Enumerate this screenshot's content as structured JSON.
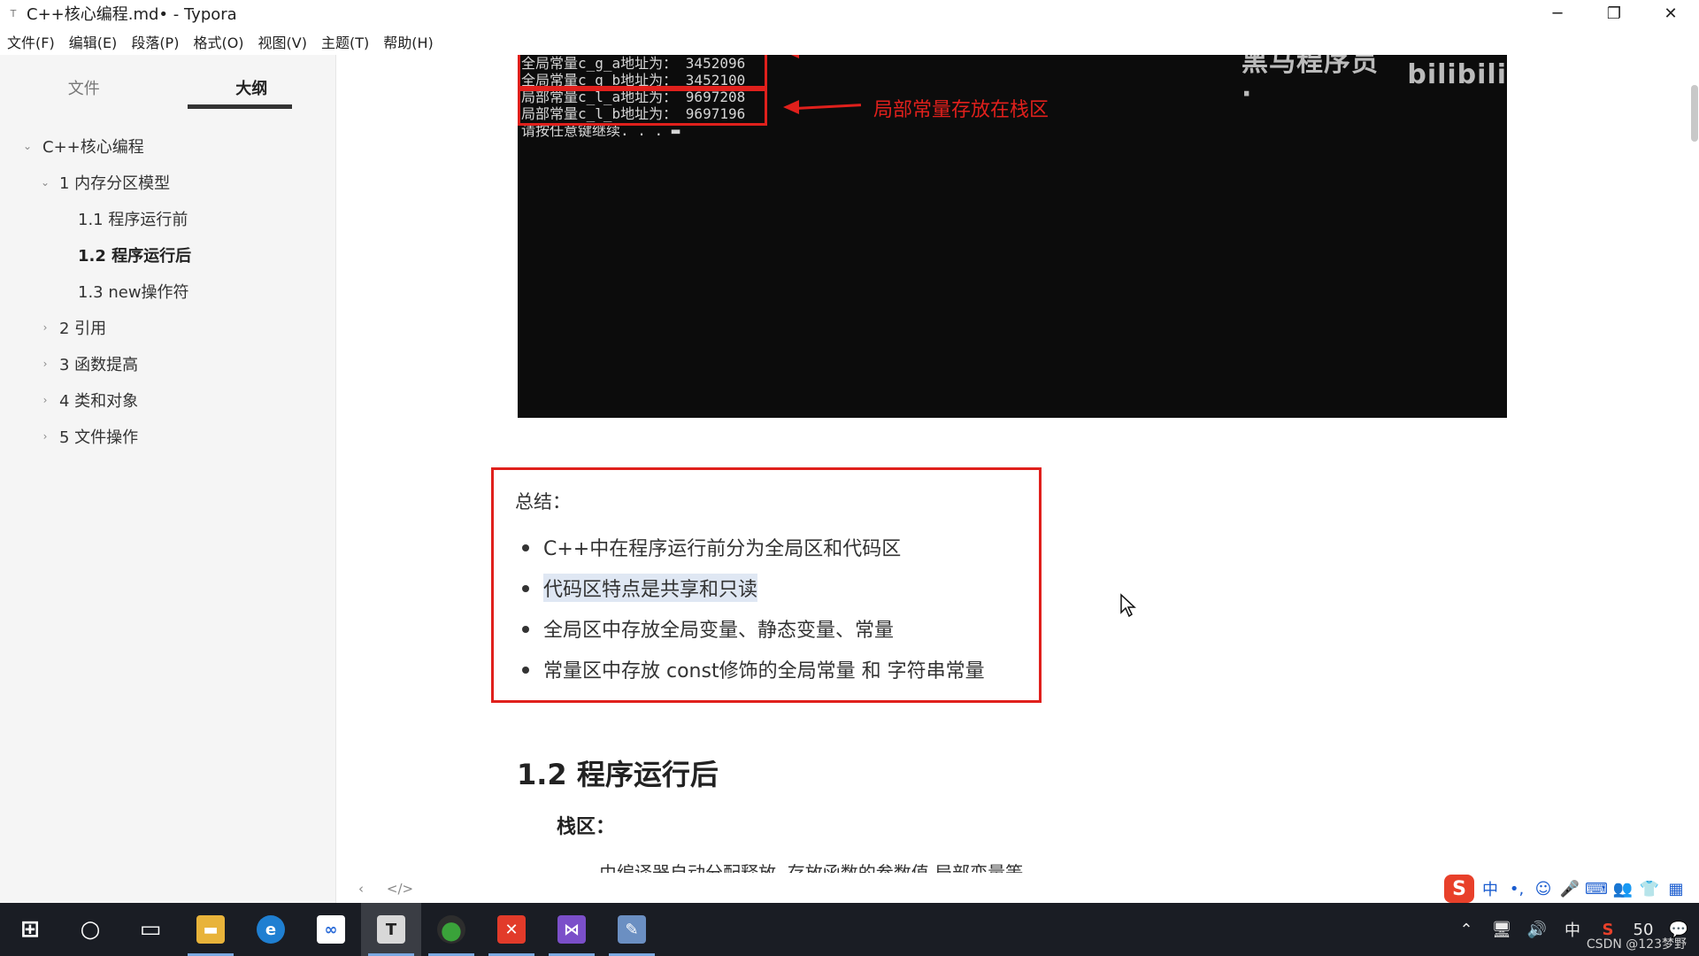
{
  "window": {
    "title": "C++核心编程.md• - Typora",
    "app_icon": "T",
    "minimize": "─",
    "restore": "❐",
    "close": "✕"
  },
  "menu": [
    "文件(F)",
    "编辑(E)",
    "段落(P)",
    "格式(O)",
    "视图(V)",
    "主题(T)",
    "帮助(H)"
  ],
  "sidebar": {
    "tabs": [
      {
        "label": "文件",
        "active": false
      },
      {
        "label": "大纲",
        "active": true
      }
    ],
    "outline": [
      {
        "text": "C++核心编程",
        "level": 1,
        "chevron": "⌄"
      },
      {
        "text": "1 内存分区模型",
        "level": 2,
        "chevron": "⌄"
      },
      {
        "text": "1.1 程序运行前",
        "level": 3,
        "chevron": ""
      },
      {
        "text": "1.2 程序运行后",
        "level": 3,
        "chevron": "",
        "current": true
      },
      {
        "text": "1.3 new操作符",
        "level": 3,
        "chevron": ""
      },
      {
        "text": "2 引用",
        "level": 2,
        "chevron": "›"
      },
      {
        "text": "3 函数提高",
        "level": 2,
        "chevron": "›"
      },
      {
        "text": "4 类和对象",
        "level": 2,
        "chevron": "›"
      },
      {
        "text": "5 文件操作",
        "level": 2,
        "chevron": "›"
      }
    ]
  },
  "console": {
    "lines": [
      "全局常量c_g_a地址为：  3452096",
      "全局常量c_g_b地址为：  3452100",
      "局部常量c_l_a地址为：  9697208",
      "局部常量c_l_b地址为：  9697196",
      "请按任意键继续. . . ▬"
    ],
    "annotation": "局部常量存放在栈区",
    "watermark_left": "黑马程序员·",
    "watermark_right": "bilibili"
  },
  "summary": {
    "title": "总结：",
    "bullets": [
      "C++中在程序运行前分为全局区和代码区",
      "代码区特点是共享和只读",
      "全局区中存放全局变量、静态变量、常量",
      "常量区中存放 const修饰的全局常量  和 字符串常量"
    ]
  },
  "content": {
    "heading": "1.2 程序运行后",
    "subheading": "栈区：",
    "cut_line": "由编译器自动分配释放, 存放函数的参数值,局部变量等"
  },
  "footer": {
    "back": "‹",
    "source": "</>"
  },
  "ime": {
    "logo": "S",
    "items": [
      "中",
      "•,",
      "☺",
      "🎤",
      "⌨",
      "👥",
      "👕",
      "▦"
    ]
  },
  "taskbar": {
    "apps": [
      {
        "name": "start",
        "glyph": "⊞",
        "color": "#1a1d24"
      },
      {
        "name": "search",
        "glyph": "○",
        "color": "#1a1d24"
      },
      {
        "name": "taskview",
        "glyph": "▭",
        "color": "#1a1d24"
      },
      {
        "name": "explorer",
        "glyph": "▬",
        "color": "#e8b33a"
      },
      {
        "name": "edge",
        "glyph": "e",
        "color": "#1f7fd1"
      },
      {
        "name": "baidu",
        "glyph": "∞",
        "color": "#2a6bd8"
      },
      {
        "name": "typora",
        "glyph": "T",
        "color": "#c9c9c9",
        "active": true
      },
      {
        "name": "green-app",
        "glyph": "●",
        "color": "#3aa23a"
      },
      {
        "name": "xmind",
        "glyph": "✕",
        "color": "#e23b2a"
      },
      {
        "name": "visual-studio",
        "glyph": "⋈",
        "color": "#7b4fc9"
      },
      {
        "name": "paint",
        "glyph": "✎",
        "color": "#6b8fc2"
      }
    ],
    "tray": [
      "⌃",
      "🖥",
      "🔊",
      "中",
      "S",
      "50",
      "💬"
    ],
    "watermark": "CSDN @123梦野"
  }
}
